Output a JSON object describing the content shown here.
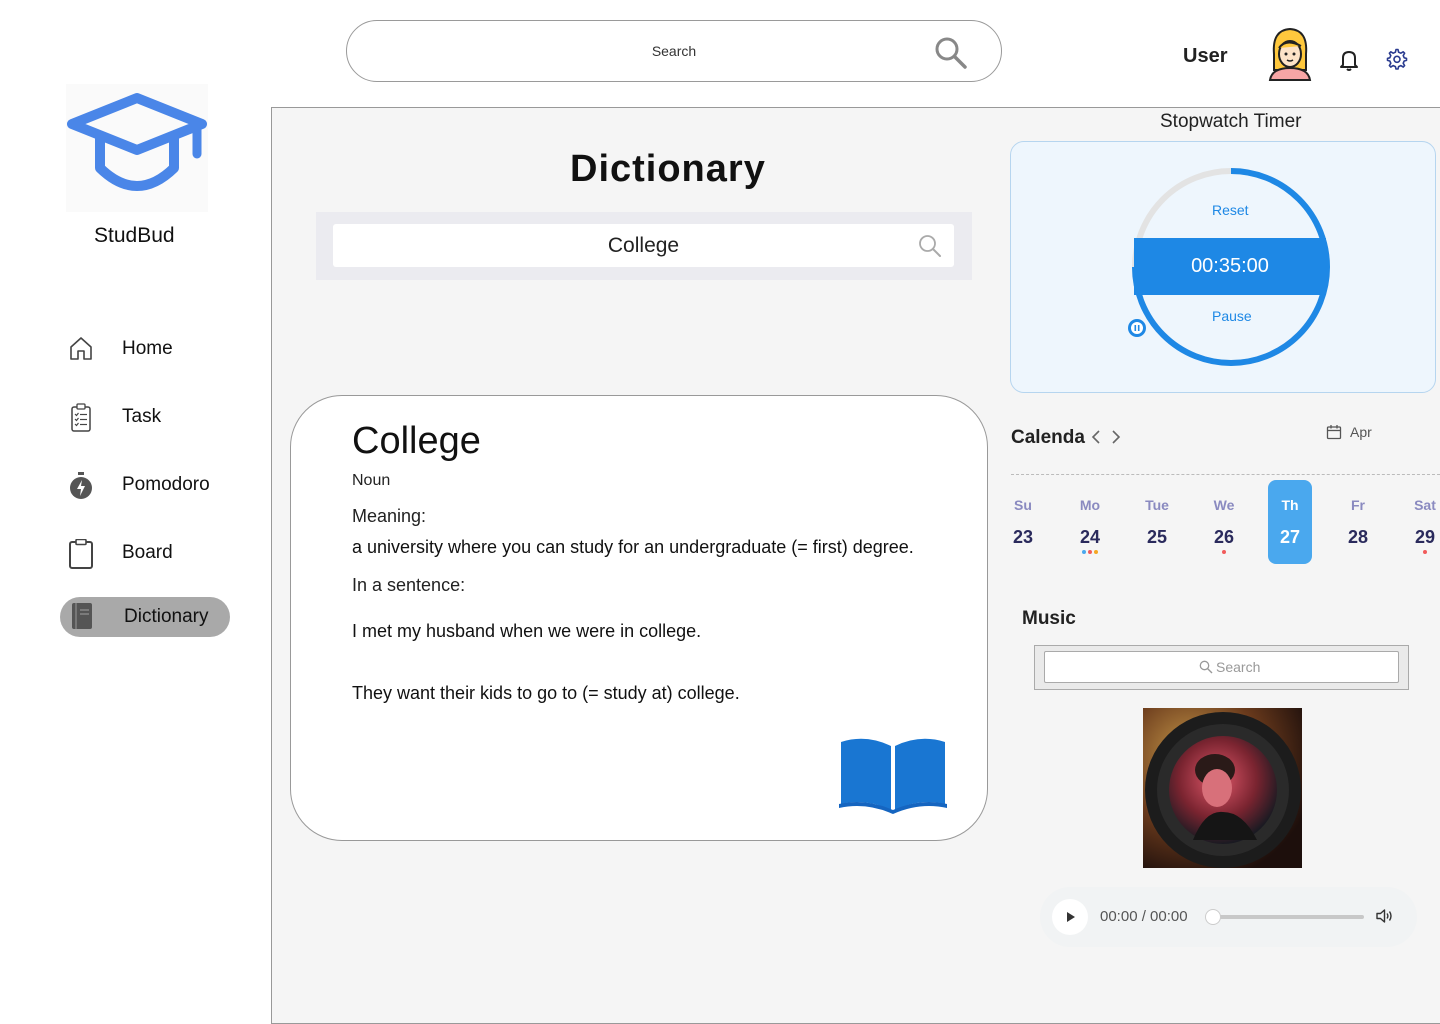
{
  "header": {
    "search_placeholder": "Search",
    "user_label": "User"
  },
  "sidebar": {
    "brand": "StudBud",
    "items": [
      {
        "label": "Home"
      },
      {
        "label": "Task"
      },
      {
        "label": "Pomodoro"
      },
      {
        "label": "Board"
      },
      {
        "label": "Dictionary",
        "active": true
      }
    ]
  },
  "dictionary": {
    "title": "Dictionary",
    "search_value": "College",
    "word": "College",
    "part_of_speech": "Noun",
    "meaning_label": "Meaning:",
    "meaning": "a university where you can study for an undergraduate (= first) degree.",
    "sentence_label": "In a sentence:",
    "sentences": [
      "I met my husband when we were in college.",
      "They want their kids to go to (= study at) college."
    ]
  },
  "stopwatch": {
    "title": "Stopwatch Timer",
    "reset_label": "Reset",
    "time": "00:35:00",
    "pause_label": "Pause",
    "progress_fraction": 0.75
  },
  "calendar": {
    "title": "Calenda",
    "month": "Apr",
    "days": [
      {
        "name": "Su",
        "date": "23",
        "dots": []
      },
      {
        "name": "Mo",
        "date": "24",
        "dots": [
          "#4aa8ee",
          "#f15b5b",
          "#f5a623"
        ]
      },
      {
        "name": "Tue",
        "date": "25",
        "dots": []
      },
      {
        "name": "We",
        "date": "26",
        "dots": [
          "#f15b5b"
        ]
      },
      {
        "name": "Th",
        "date": "27",
        "dots": [],
        "selected": true
      },
      {
        "name": "Fr",
        "date": "28",
        "dots": []
      },
      {
        "name": "Sat",
        "date": "29",
        "dots": [
          "#f15b5b"
        ]
      }
    ]
  },
  "music": {
    "title": "Music",
    "search_placeholder": "Search",
    "player_time": "00:00 / 00:00"
  },
  "colors": {
    "accent": "#1e88e5",
    "brand_logo": "#4a86e8",
    "selected_day": "#4aa8ee"
  }
}
